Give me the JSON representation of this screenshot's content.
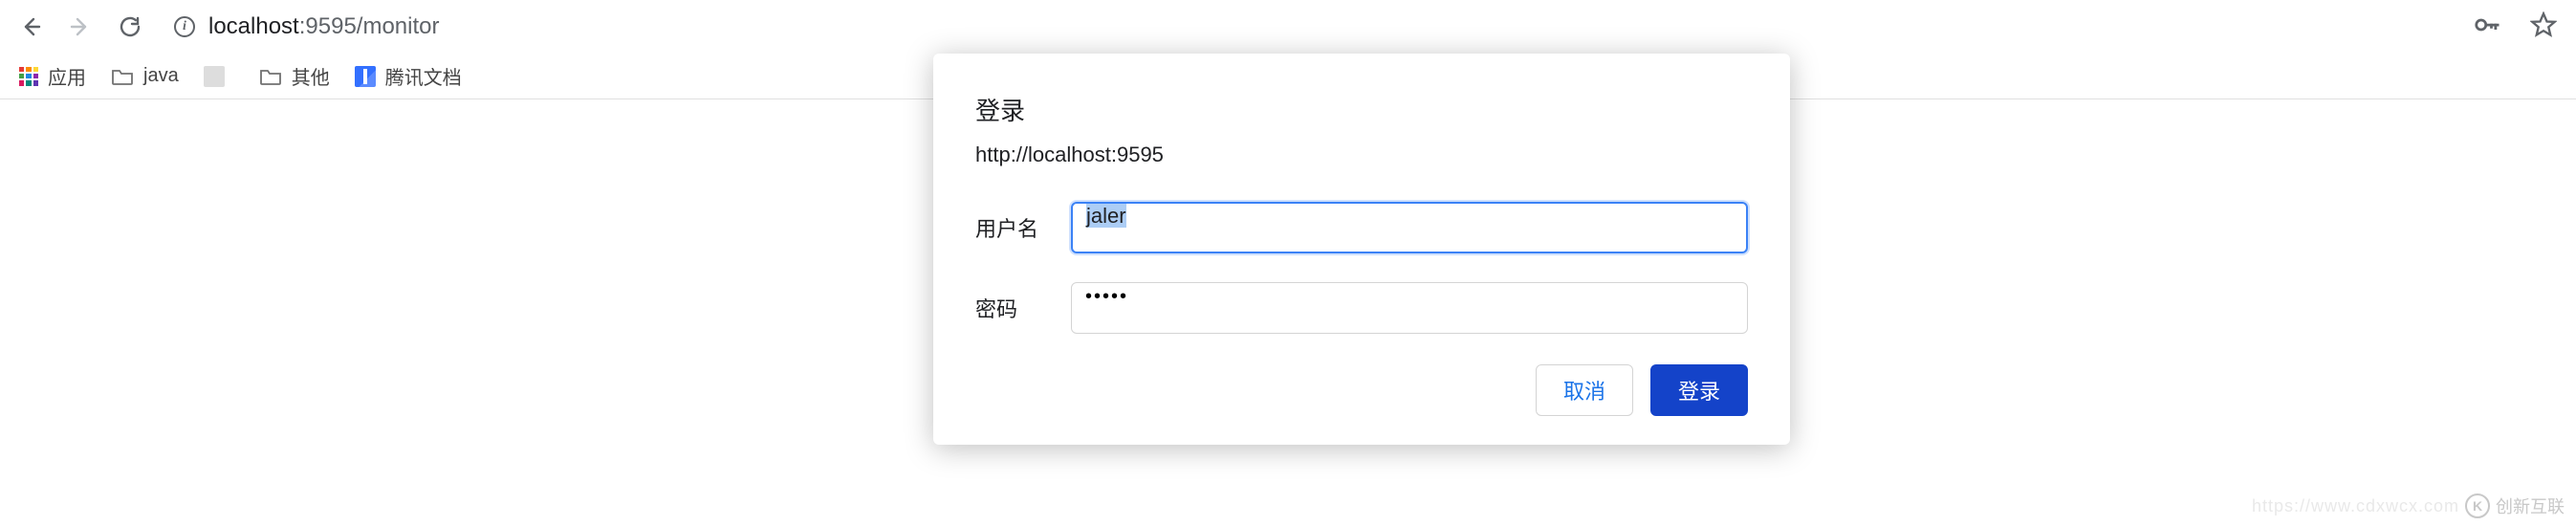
{
  "browser": {
    "address": {
      "host": "localhost",
      "port": ":9595",
      "path": "/monitor"
    }
  },
  "bookmarks": {
    "apps_label": "应用",
    "items": [
      {
        "label": "java"
      },
      {
        "label": ""
      },
      {
        "label": "其他"
      },
      {
        "label": "腾讯文档"
      }
    ]
  },
  "modal": {
    "title": "登录",
    "subtitle": "http://localhost:9595",
    "username_label": "用户名",
    "username_value": "jaler",
    "password_label": "密码",
    "password_value": "•••••",
    "cancel_label": "取消",
    "submit_label": "登录"
  },
  "watermark": {
    "ghost": "https://www.cdxwcx.com",
    "text": "创新互联"
  }
}
